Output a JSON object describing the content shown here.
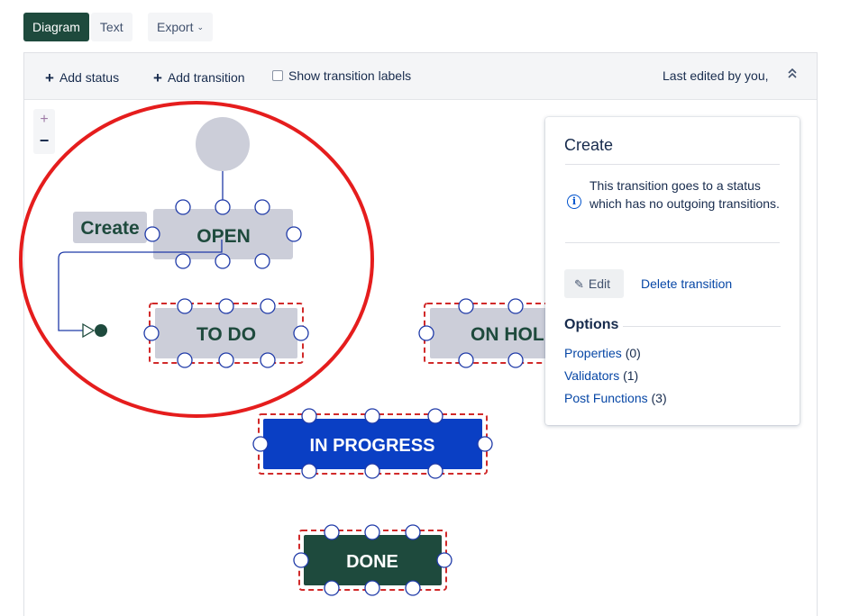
{
  "tabs": {
    "diagram": "Diagram",
    "text": "Text",
    "export": "Export"
  },
  "toolbar": {
    "add_status": "Add status",
    "add_transition": "Add transition",
    "show_labels": "Show transition labels",
    "last_edited": "Last edited by you,"
  },
  "zoom": {
    "in": "+",
    "out": "−"
  },
  "statuses": {
    "open": "OPEN",
    "todo": "TO DO",
    "on_hold": "ON HOL",
    "in_progress": "IN PROGRESS",
    "done": "DONE"
  },
  "transition_label": "Create",
  "panel": {
    "title": "Create",
    "info": "This transition goes to a status which has no outgoing transitions.",
    "edit": "Edit",
    "delete": "Delete transition",
    "options_title": "Options",
    "options": [
      {
        "label": "Properties",
        "count": "(0)"
      },
      {
        "label": "Validators",
        "count": "(1)"
      },
      {
        "label": "Post Functions",
        "count": "(3)"
      }
    ]
  },
  "colors": {
    "accent_dark_green": "#1e4a3d",
    "status_grey": "#ccced9",
    "in_progress_blue": "#0a3fc4",
    "link_blue": "#0747a6",
    "annotation_red": "#e51d1d"
  }
}
